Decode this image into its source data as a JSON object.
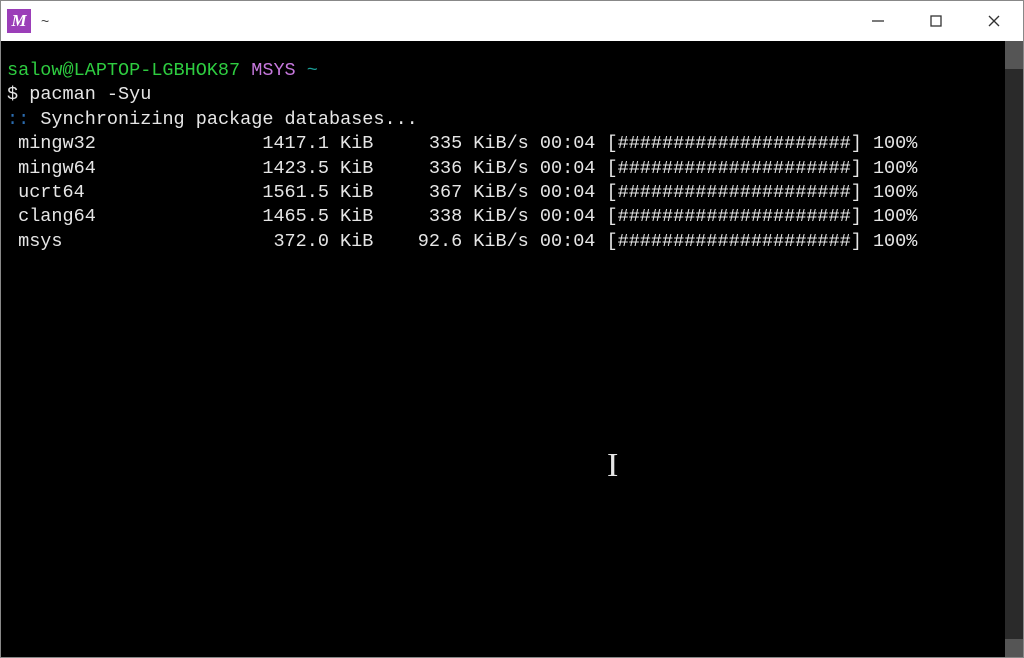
{
  "titlebar": {
    "app_icon_letter": "M",
    "title": "~"
  },
  "prompt": {
    "user_host": "salow@LAPTOP-LGBHOK87",
    "shell": "MSYS",
    "cwd": "~",
    "symbol": "$",
    "command": "pacman -Syu"
  },
  "sync": {
    "marker": "::",
    "message": "Synchronizing package databases..."
  },
  "progress_bar": "[#####################]",
  "downloads": [
    {
      "name": "mingw32",
      "size": "1417.1 KiB",
      "speed": " 335 KiB/s",
      "eta": "00:04",
      "percent": "100%"
    },
    {
      "name": "mingw64",
      "size": "1423.5 KiB",
      "speed": " 336 KiB/s",
      "eta": "00:04",
      "percent": "100%"
    },
    {
      "name": "ucrt64",
      "size": "1561.5 KiB",
      "speed": " 367 KiB/s",
      "eta": "00:04",
      "percent": "100%"
    },
    {
      "name": "clang64",
      "size": "1465.5 KiB",
      "speed": " 338 KiB/s",
      "eta": "00:04",
      "percent": "100%"
    },
    {
      "name": "msys",
      "size": " 372.0 KiB",
      "speed": "92.6 KiB/s",
      "eta": "00:04",
      "percent": "100%"
    }
  ]
}
